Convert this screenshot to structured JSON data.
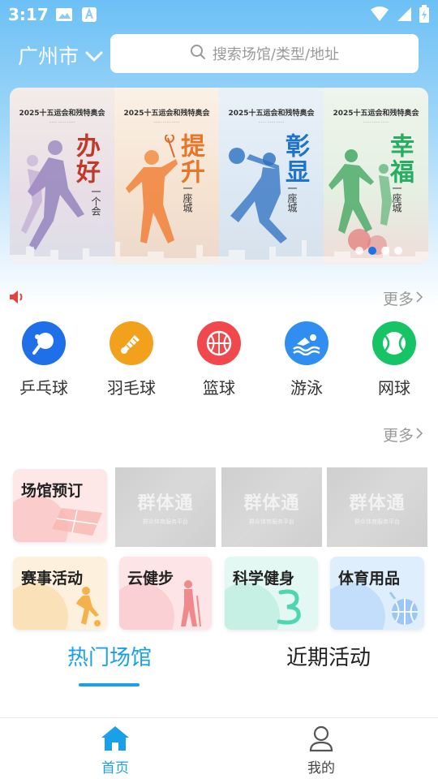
{
  "status_bar": {
    "time": "3:17"
  },
  "header": {
    "city": "广州市",
    "search_placeholder": "搜索场馆/类型/地址"
  },
  "banner": {
    "panels": [
      {
        "title": "2025十五运会和残特奥会",
        "big_text": "办好",
        "small_text": "一个会",
        "color": "#c0392b"
      },
      {
        "title": "2025十五运会和残特奥会",
        "big_text": "提升",
        "small_text": "一座城",
        "color": "#e67e22"
      },
      {
        "title": "2025十五运会和残特奥会",
        "big_text": "彰显",
        "small_text": "一座城",
        "color": "#1f73c9"
      },
      {
        "title": "2025十五运会和残特奥会",
        "big_text": "幸福",
        "small_text": "一座城",
        "color": "#27ae60"
      }
    ],
    "active_index": 1
  },
  "notice": {
    "more_label": "更多"
  },
  "categories": [
    {
      "label": "乒乓球",
      "icon": "ping-pong-icon",
      "color": "#1e6fe8"
    },
    {
      "label": "羽毛球",
      "icon": "badminton-icon",
      "color": "#f2a11c"
    },
    {
      "label": "篮球",
      "icon": "basketball-icon",
      "color": "#f0484d"
    },
    {
      "label": "游泳",
      "icon": "swimming-icon",
      "color": "#2f8ef0"
    },
    {
      "label": "网球",
      "icon": "tennis-icon",
      "color": "#16c466"
    }
  ],
  "services": {
    "more_label": "更多",
    "tiles": [
      {
        "label": "场馆预订",
        "bg": "#fde7e7",
        "accent": "#fbcccc"
      },
      {
        "label": "赛事活动",
        "bg": "#fdf0dc",
        "accent": "#fbe1b8"
      },
      {
        "label": "云健步",
        "bg": "#fde4e6",
        "accent": "#fbd0d4"
      },
      {
        "label": "科学健身",
        "bg": "#e3f8f2",
        "accent": "#c6f0e4"
      },
      {
        "label": "体育用品",
        "bg": "#dfeefd",
        "accent": "#c2defb"
      }
    ],
    "placeholder_brand": "群体通",
    "placeholder_sub": "群众体育服务平台"
  },
  "tabs": [
    {
      "label": "热门场馆",
      "active": true
    },
    {
      "label": "近期活动",
      "active": false
    }
  ],
  "bottom_nav": [
    {
      "label": "首页",
      "icon": "home-icon",
      "active": true
    },
    {
      "label": "我的",
      "icon": "profile-icon",
      "active": false
    }
  ],
  "colors": {
    "accent": "#1aa0e8",
    "header_gradient_top": "#6cc0f5"
  }
}
